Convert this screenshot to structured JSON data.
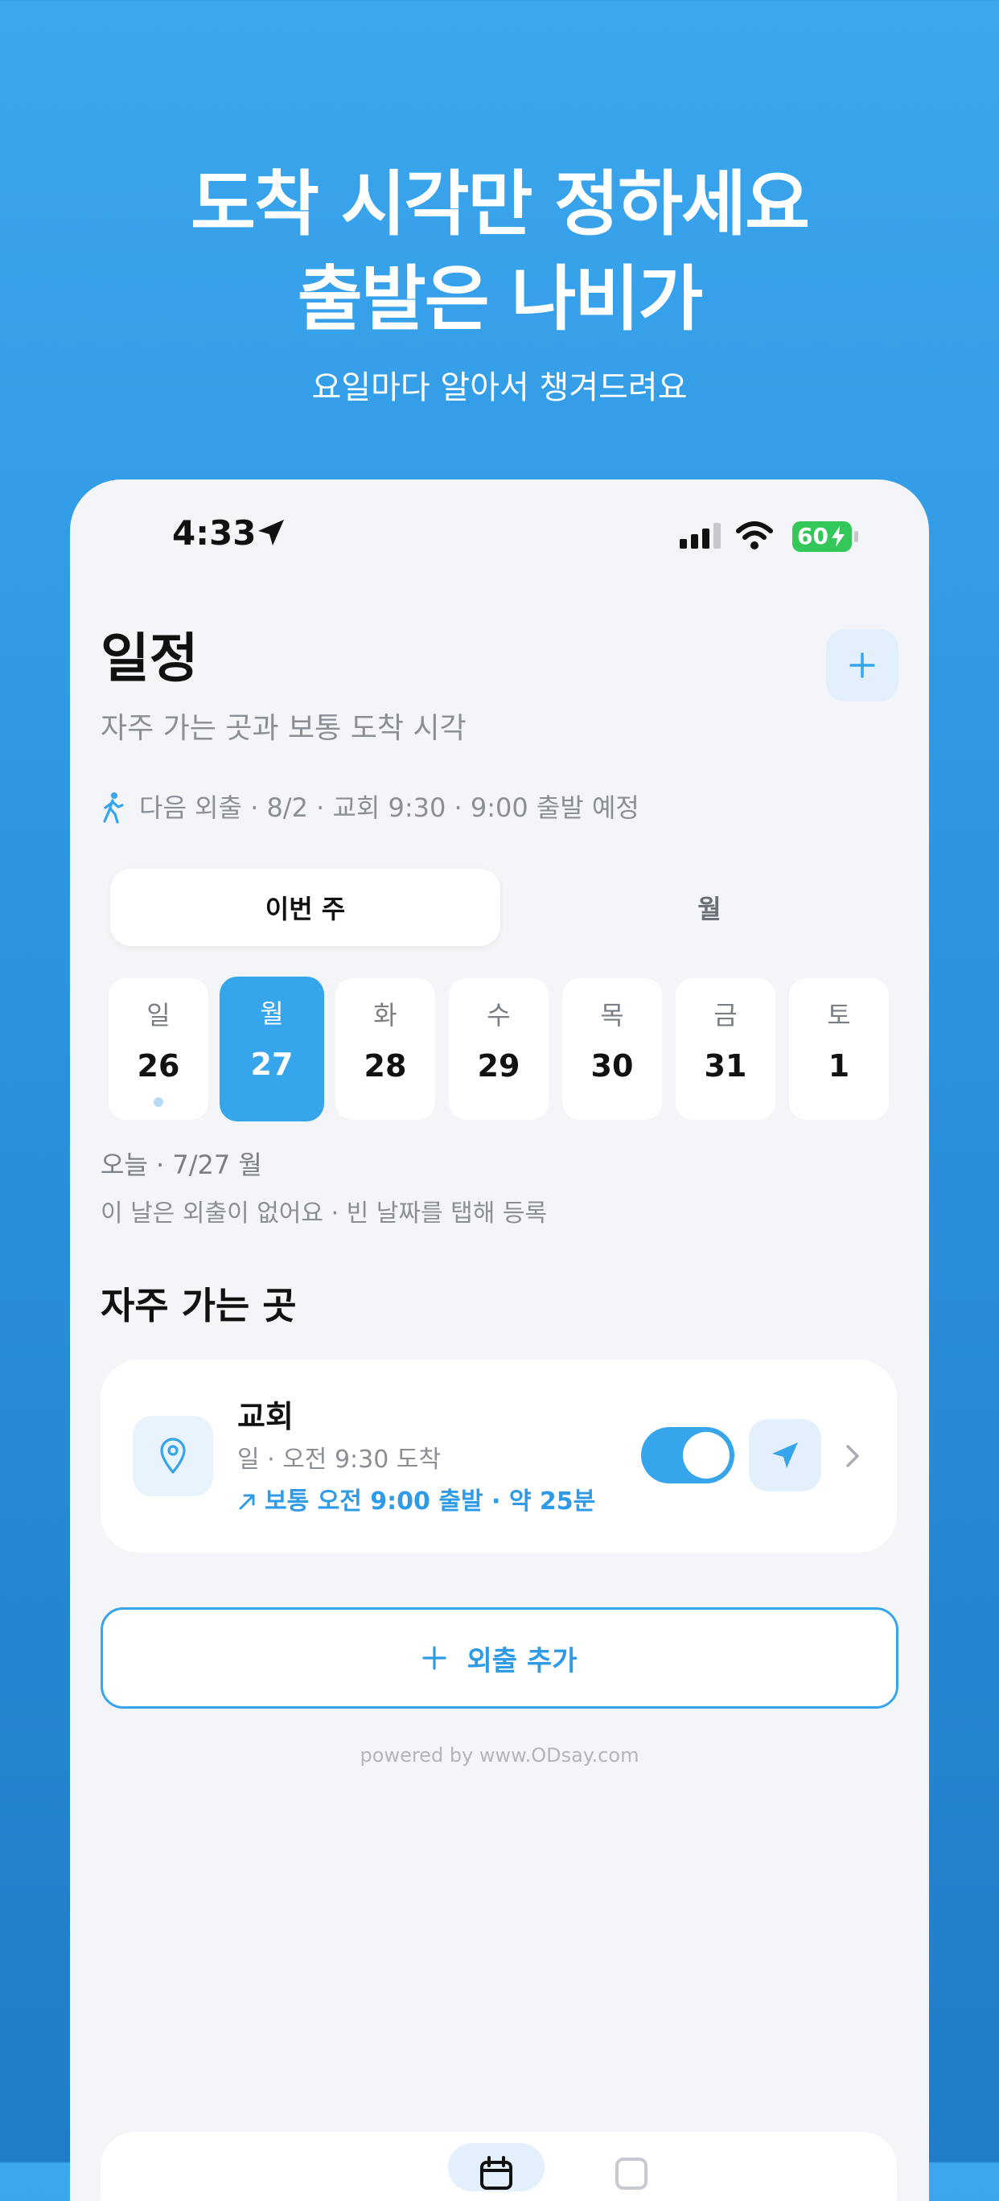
{
  "hero": {
    "title_line1": "도착 시각만 정하세요",
    "title_line2": "출발은 나비가",
    "subtitle": "요일마다 알아서 챙겨드려요"
  },
  "status_bar": {
    "time": "4:33",
    "battery": "60",
    "icons": [
      "location-arrow-icon",
      "signal-icon",
      "wifi-icon",
      "battery-charging-icon"
    ]
  },
  "header": {
    "title": "일정",
    "subtitle": "자주 가는 곳과 보통 도착 시각",
    "add_icon": "plus-icon"
  },
  "next_outing": {
    "icon": "walking-person-icon",
    "text": "다음 외출 · 8/2 · 교회 9:30 · 9:00 출발 예정"
  },
  "segment": {
    "options": [
      "이번 주",
      "월"
    ],
    "selected": "이번 주"
  },
  "week": {
    "days": [
      {
        "name": "일",
        "num": "26",
        "has_dot": true
      },
      {
        "name": "월",
        "num": "27",
        "selected": true
      },
      {
        "name": "화",
        "num": "28"
      },
      {
        "name": "수",
        "num": "29"
      },
      {
        "name": "목",
        "num": "30"
      },
      {
        "name": "금",
        "num": "31"
      },
      {
        "name": "토",
        "num": "1"
      }
    ]
  },
  "selected_day": {
    "label": "오늘 · 7/27 월",
    "empty_message": "이 날은 외출이 없어요 · 빈 날짜를 탭해 등록"
  },
  "frequent": {
    "title": "자주 가는 곳",
    "places": [
      {
        "icon": "location-pin-icon",
        "name": "교회",
        "arrival": "일 · 오전 9:30 도착",
        "departure": "보통 오전 9:00 출발 · 약 25분",
        "enabled": true
      }
    ]
  },
  "add_outing": {
    "label": "외출 추가"
  },
  "footer": {
    "powered_by": "powered by www.ODsay.com"
  },
  "colors": {
    "brand": "#36a5ec",
    "background": "#f3f5f8",
    "hero_gradient_top": "#3ba7ee",
    "hero_gradient_bottom": "#1f7cc8"
  }
}
